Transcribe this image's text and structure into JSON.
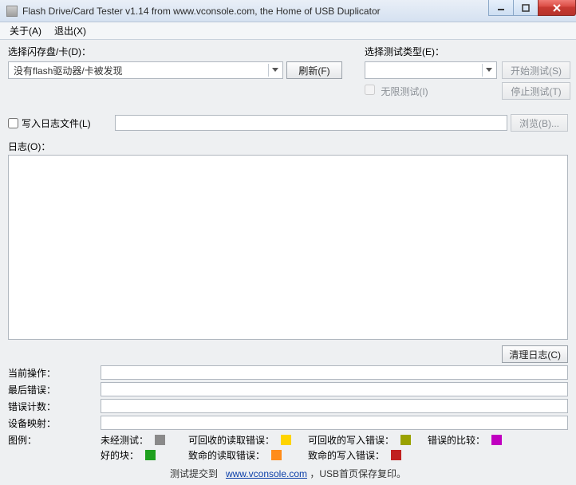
{
  "window": {
    "title": "Flash Drive/Card Tester v1.14 from www.vconsole.com, the Home of USB Duplicator"
  },
  "menu": {
    "about": "关于(A)",
    "exit": "退出(X)"
  },
  "flash": {
    "section_label": "选择闪存盘/卡(D)：",
    "selected_text": "没有flash驱动器/卡被发现",
    "refresh_btn": "刷新(F)"
  },
  "testtype": {
    "section_label": "选择测试类型(E)：",
    "selected_text": "",
    "infinite_checkbox_label": "无限测试(I)",
    "infinite_checked": false
  },
  "controls": {
    "start_btn": "开始测试(S)",
    "stop_btn": "停止测试(T)"
  },
  "logfile": {
    "checkbox_label": "写入日志文件(L)",
    "checked": false,
    "path_value": "",
    "browse_btn": "浏览(B)..."
  },
  "log": {
    "label": "日志(O)：",
    "content": "",
    "clear_btn": "清理日志(C)"
  },
  "status": {
    "current_op_label": "当前操作：",
    "current_op_value": "",
    "last_error_label": "最后错误：",
    "last_error_value": "",
    "error_count_label": "错误计数：",
    "error_count_value": "",
    "device_map_label": "设备映射：",
    "device_map_value": ""
  },
  "legend": {
    "label": "图例：",
    "items": {
      "untested": {
        "label": "未经测试：",
        "color": "#8a8a8a"
      },
      "recov_read": {
        "label": "可回收的读取错误：",
        "color": "#ffd400"
      },
      "recov_write": {
        "label": "可回收的写入错误：",
        "color": "#9aa200"
      },
      "compare_err": {
        "label": "错误的比较：",
        "color": "#c000c0"
      },
      "good": {
        "label": "好的块：",
        "color": "#1fa01f"
      },
      "fatal_read": {
        "label": "致命的读取错误：",
        "color": "#ff8c1a"
      },
      "fatal_write": {
        "label": "致命的写入错误：",
        "color": "#c02020"
      }
    }
  },
  "footer": {
    "prefix": "测试提交到",
    "link_text": "www.vconsole.com",
    "suffix": "，USB首页保存复印。"
  }
}
